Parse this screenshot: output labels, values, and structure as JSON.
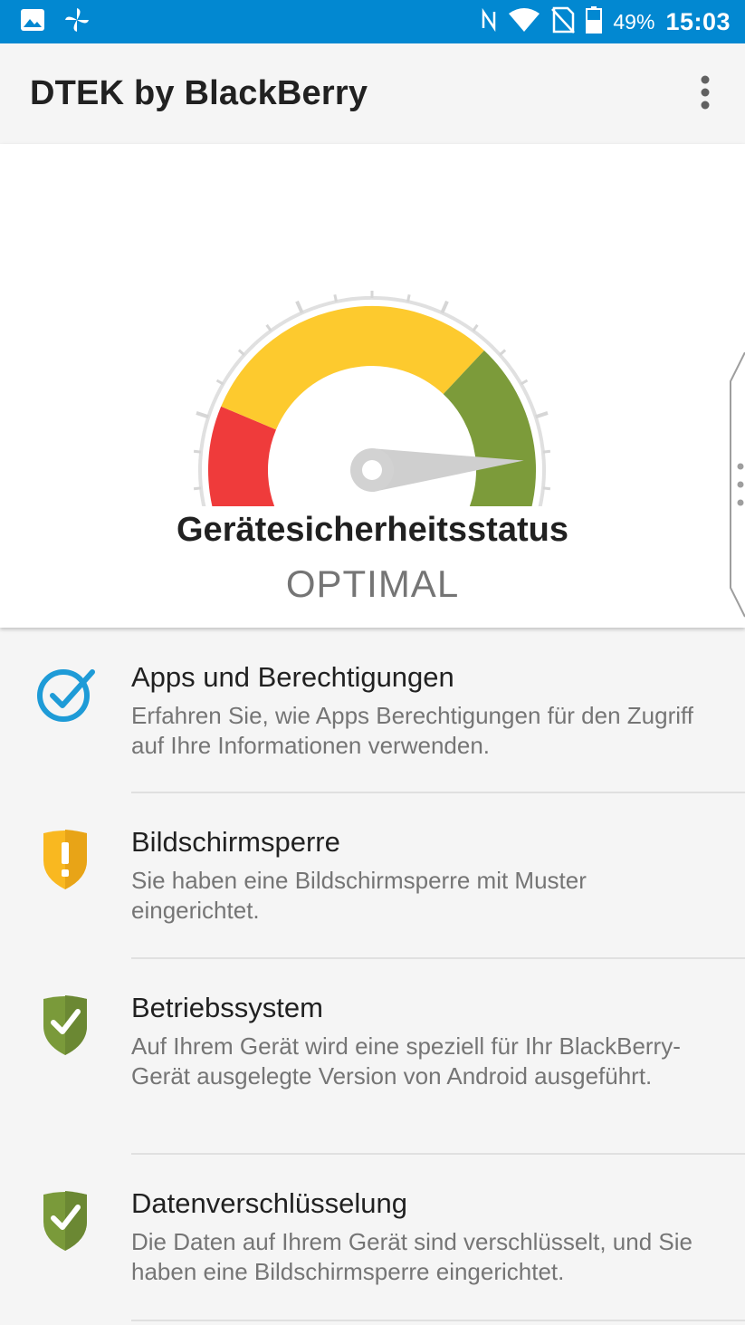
{
  "status_bar": {
    "battery_percent": "49%",
    "time": "15:03",
    "icons": [
      "image-icon",
      "pinwheel-icon",
      "nfc-icon",
      "wifi-icon",
      "no-sim-icon",
      "battery-icon"
    ]
  },
  "app_bar": {
    "title": "DTEK by BlackBerry",
    "menu_icon": "more-vert-icon"
  },
  "gauge": {
    "label": "Gerätesicherheitsstatus",
    "value": "OPTIMAL",
    "level_fraction": 0.86,
    "segment_colors": {
      "low": "#ef3b3b",
      "mid": "#fdca2e",
      "high": "#7c9b3a"
    }
  },
  "items": [
    {
      "icon": "check-circle-icon",
      "title": "Apps und Berechtigungen",
      "desc": "Erfahren Sie, wie Apps Berechtigungen für den Zugriff auf Ihre Informationen verwenden."
    },
    {
      "icon": "warning-shield-icon",
      "title": "Bildschirmsperre",
      "desc": "Sie haben eine Bildschirmsperre mit Muster eingerichtet."
    },
    {
      "icon": "check-shield-icon",
      "title": "Betriebssystem",
      "desc": "Auf Ihrem Gerät wird eine speziell für Ihr BlackBerry-Gerät ausgelegte Version von Android ausgeführt."
    },
    {
      "icon": "check-shield-icon",
      "title": "Datenverschlüsselung",
      "desc": "Die Daten auf Ihrem Gerät sind verschlüsselt, und Sie haben eine Bildschirmsperre eingerichtet."
    }
  ],
  "colors": {
    "status_bar": "#0288d1",
    "accent_blue": "#1e9bd7",
    "warning_yellow": "#f9b820",
    "ok_green": "#7a9a3a"
  }
}
